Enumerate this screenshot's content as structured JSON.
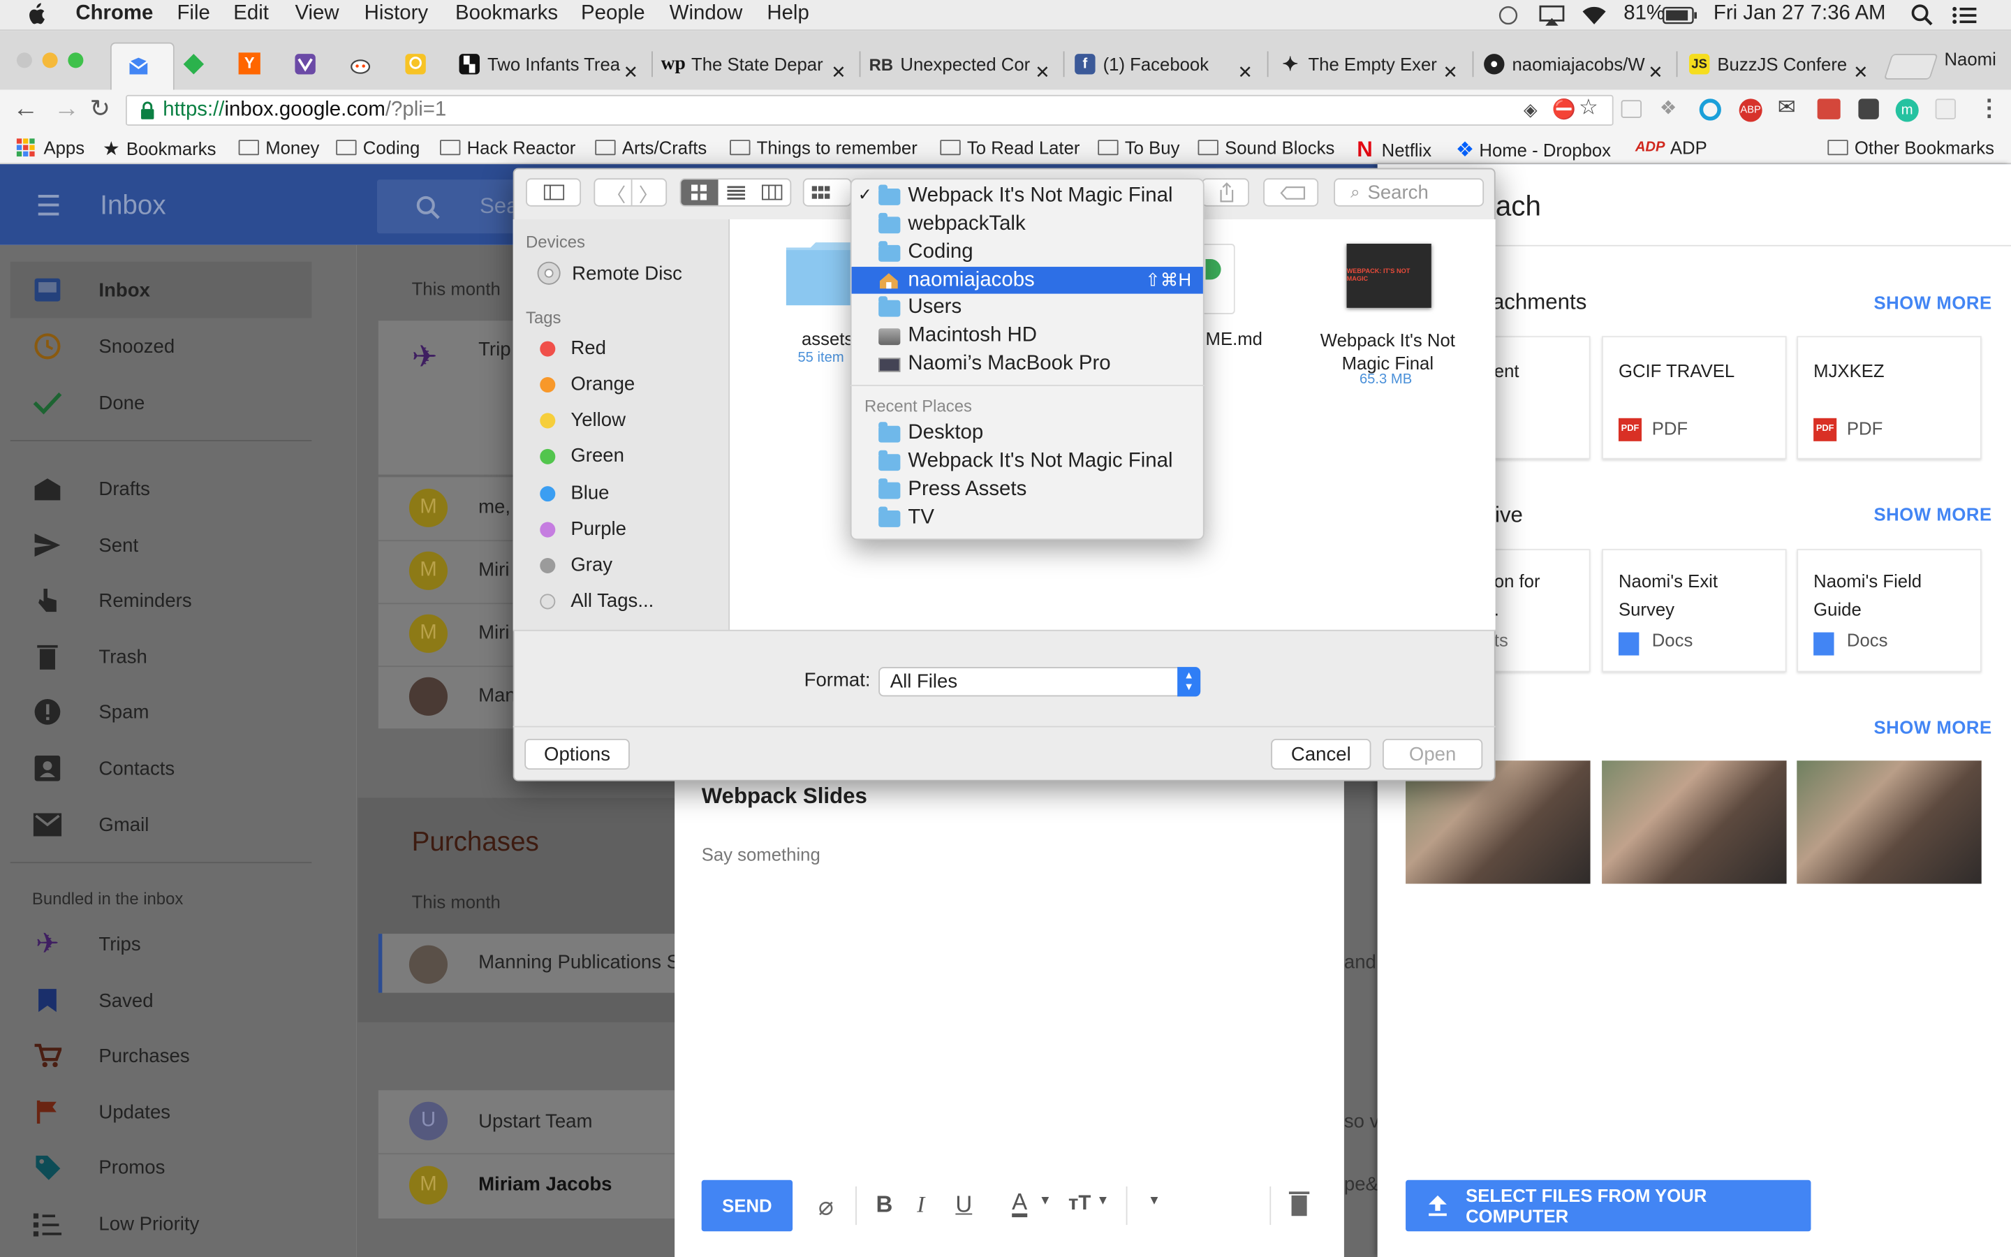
{
  "menubar": {
    "apple": "",
    "items": [
      "Chrome",
      "File",
      "Edit",
      "View",
      "History",
      "Bookmarks",
      "People",
      "Window",
      "Help"
    ],
    "battery": "81%",
    "clock": "Fri Jan 27  7:36 AM"
  },
  "tabs": [
    {
      "label": "Two Infants Trea",
      "favicon": "tab-icon"
    },
    {
      "label": "The State Depar",
      "favicon": "wp-icon"
    },
    {
      "label": "Unexpected Cor",
      "favicon": "rb-icon"
    },
    {
      "label": "(1) Facebook",
      "favicon": "facebook-icon"
    },
    {
      "label": "The Empty Exer",
      "favicon": "pin-icon"
    },
    {
      "label": "naomiajacobs/W",
      "favicon": "github-icon"
    },
    {
      "label": "BuzzJS Confere",
      "favicon": "js-icon"
    }
  ],
  "profile_name": "Naomi",
  "address": {
    "scheme": "https://",
    "host": "inbox.google.com",
    "path": "/?pli=1"
  },
  "bookmarks": [
    {
      "label": "Apps",
      "icon": "apps-grid-icon"
    },
    {
      "label": "Bookmarks",
      "icon": "star-icon"
    },
    {
      "label": "Money",
      "icon": "folder-icon"
    },
    {
      "label": "Coding",
      "icon": "folder-icon"
    },
    {
      "label": "Hack Reactor",
      "icon": "folder-icon"
    },
    {
      "label": "Arts/Crafts",
      "icon": "folder-icon"
    },
    {
      "label": "Things to remember",
      "icon": "folder-icon"
    },
    {
      "label": "To Read Later",
      "icon": "folder-icon"
    },
    {
      "label": "To Buy",
      "icon": "folder-icon"
    },
    {
      "label": "Sound Blocks",
      "icon": "folder-icon"
    },
    {
      "label": "Netflix",
      "icon": "netflix-icon"
    },
    {
      "label": "Home - Dropbox",
      "icon": "dropbox-icon"
    },
    {
      "label": "ADP",
      "icon": "adp-icon"
    }
  ],
  "other_bookmarks": "Other Bookmarks",
  "inbox": {
    "title": "Inbox",
    "search_placeholder": "Sea",
    "nav": [
      {
        "label": "Inbox",
        "icon": "inbox-icon"
      },
      {
        "label": "Snoozed",
        "icon": "clock-icon"
      },
      {
        "label": "Done",
        "icon": "check-icon"
      },
      {
        "label": "Drafts",
        "icon": "drafts-icon"
      },
      {
        "label": "Sent",
        "icon": "send-icon"
      },
      {
        "label": "Reminders",
        "icon": "reminder-icon"
      },
      {
        "label": "Trash",
        "icon": "trash-icon"
      },
      {
        "label": "Spam",
        "icon": "spam-icon"
      },
      {
        "label": "Contacts",
        "icon": "contacts-icon"
      },
      {
        "label": "Gmail",
        "icon": "gmail-icon"
      }
    ],
    "bundled_heading": "Bundled in the inbox",
    "bundles": [
      {
        "label": "Trips",
        "icon": "plane-icon"
      },
      {
        "label": "Saved",
        "icon": "bookmark-icon"
      },
      {
        "label": "Purchases",
        "icon": "cart-icon"
      },
      {
        "label": "Updates",
        "icon": "flag-icon"
      },
      {
        "label": "Promos",
        "icon": "tag-icon"
      },
      {
        "label": "Low Priority",
        "icon": "low-priority-icon"
      }
    ],
    "this_month": "This month",
    "trip_label": "Trip",
    "rows": [
      {
        "avatar": "M",
        "sender": "me,"
      },
      {
        "avatar": "M",
        "sender": "Miri"
      },
      {
        "avatar": "M",
        "sender": "Miri"
      },
      {
        "avatar": "",
        "sender": "Man"
      }
    ],
    "purchases_title": "Purchases",
    "purchases_this_month": "This month",
    "manning": "Manning Publications Su",
    "manning_tail": "and c",
    "upstart_avatar": "U",
    "upstart": "Upstart Team",
    "upstart_tail": "so v",
    "miriam_avatar": "M",
    "miriam": "Miriam Jacobs",
    "miriam_tail": "pe&v"
  },
  "compose": {
    "subject": "Webpack Slides",
    "body_placeholder": "Say something",
    "send": "SEND"
  },
  "attach_panel": {
    "title": "tach",
    "attachments_heading": "ttachments",
    "show_more": "SHOW MORE",
    "attachments": [
      {
        "name": "ent",
        "type": ""
      },
      {
        "name": "GCIF TRAVEL",
        "type": "PDF"
      },
      {
        "name": "MJXKEZ",
        "type": "PDF"
      }
    ],
    "drive_heading": "rive",
    "drive": [
      {
        "line1": "on for",
        "line2": ".",
        "type": "ts"
      },
      {
        "line1": "Naomi's Exit",
        "line2": "Survey",
        "type": "Docs"
      },
      {
        "line1": "Naomi's Field",
        "line2": "Guide",
        "type": "Docs"
      }
    ],
    "select_files": "SELECT FILES FROM YOUR COMPUTER"
  },
  "dialog": {
    "search_placeholder": "Search",
    "devices_heading": "Devices",
    "devices": [
      "Remote Disc"
    ],
    "tags_heading": "Tags",
    "tags": [
      {
        "label": "Red",
        "color": "#f0504a"
      },
      {
        "label": "Orange",
        "color": "#f8982a"
      },
      {
        "label": "Yellow",
        "color": "#f6ce3b"
      },
      {
        "label": "Green",
        "color": "#52c54d"
      },
      {
        "label": "Blue",
        "color": "#3b9ef2"
      },
      {
        "label": "Purple",
        "color": "#c57de0"
      },
      {
        "label": "Gray",
        "color": "#9b9b9b"
      },
      {
        "label": "All Tags...",
        "color": "#e0e0e0"
      }
    ],
    "files": [
      {
        "name": "assets",
        "meta": "55 item"
      },
      {
        "name": "ME.md",
        "meta": ""
      },
      {
        "name": "Webpack It's Not Magic Final",
        "meta": "65.3 MB",
        "thumb_text": "WEBPACK: IT'S NOT MAGIC"
      }
    ],
    "format_label": "Format:",
    "format_value": "All Files",
    "options": "Options",
    "cancel": "Cancel",
    "open": "Open"
  },
  "path_menu": {
    "items": [
      {
        "label": "Webpack It's Not Magic Final",
        "checked": "✓"
      },
      {
        "label": "webpackTalk"
      },
      {
        "label": "Coding"
      },
      {
        "label": "naomiajacobs",
        "shortcut": "⇧⌘H"
      },
      {
        "label": "Users"
      },
      {
        "label": "Macintosh HD"
      },
      {
        "label": "Naomi’s MacBook Pro"
      }
    ],
    "recent_heading": "Recent Places",
    "recent": [
      "Desktop",
      "Webpack It's Not Magic Final",
      "Press Assets",
      "TV"
    ]
  }
}
